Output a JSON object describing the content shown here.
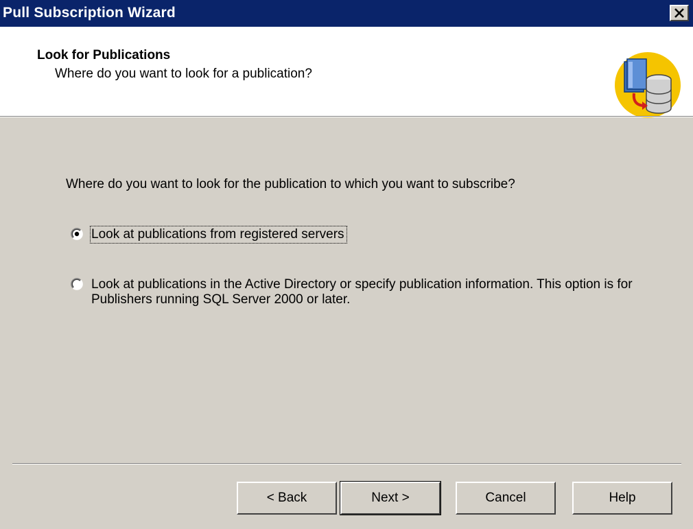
{
  "window": {
    "title": "Pull Subscription Wizard"
  },
  "header": {
    "title": "Look for Publications",
    "subtitle": "Where do you want to look for a publication?",
    "icon": "database-publication-icon"
  },
  "main": {
    "question": "Where do you want to look for the publication to which you want to subscribe?",
    "options": [
      {
        "label": "Look at publications from registered servers",
        "selected": true
      },
      {
        "label": "Look at publications in the Active Directory or specify publication information. This option is for Publishers running SQL Server 2000 or later.",
        "selected": false
      }
    ]
  },
  "buttons": {
    "back": "< Back",
    "next": "Next >",
    "cancel": "Cancel",
    "help": "Help"
  },
  "colors": {
    "titlebar": "#0a246a",
    "face": "#d4d0c8",
    "header_bg": "#ffffff"
  }
}
